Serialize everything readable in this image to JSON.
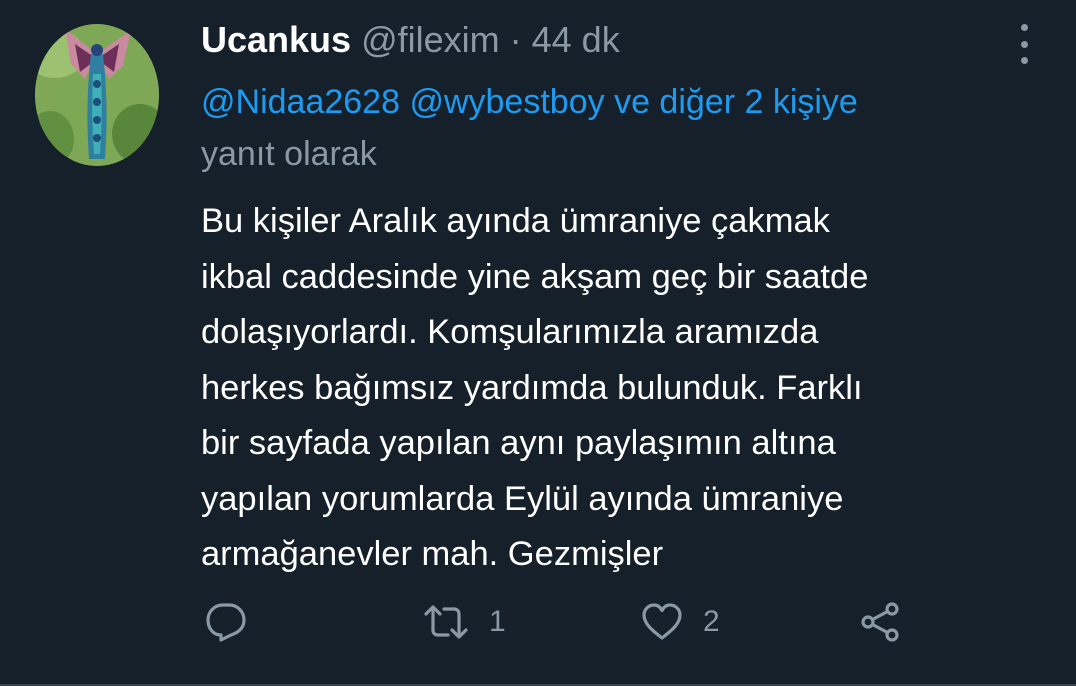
{
  "tweet": {
    "display_name": "Ucankus",
    "handle": "@filexim",
    "separator": "·",
    "time": "44 dk",
    "reply_to": {
      "mention1": "@Nidaa2628",
      "mention2": "@wybestboy",
      "others": "ve diğer 2 kişiye",
      "suffix": "yanıt olarak"
    },
    "text": "Bu kişiler Aralık ayında ümraniye çakmak\nikbal caddesinde yine akşam geç bir saatde\ndolaşıyorlardı. Komşularımızla aramızda\nherkes bağımsız yardımda bulunduk. Farklı\nbir sayfada yapılan aynı paylaşımın altına\nyapılan yorumlarda Eylül ayında ümraniye\narmağanevler mah. Gezmişler",
    "actions": {
      "reply_icon": "reply-icon",
      "retweet_icon": "retweet-icon",
      "retweet_count": "1",
      "like_icon": "heart-icon",
      "like_count": "2",
      "share_icon": "share-icon"
    }
  },
  "colors": {
    "background": "#15202b",
    "secondary_text": "#8b98a5",
    "accent": "#1d9bf0",
    "divider": "#38444d"
  }
}
